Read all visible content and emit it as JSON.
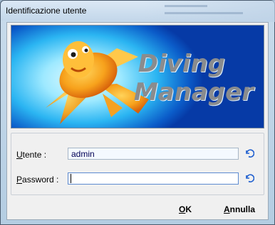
{
  "window": {
    "title": "Identificazione utente"
  },
  "banner": {
    "line1": "Diving",
    "line2": "Manager"
  },
  "form": {
    "username_label_key": "U",
    "username_label_rest": "tente :",
    "username_value": "admin",
    "password_label_key": "P",
    "password_label_rest": "assword :",
    "password_value": ""
  },
  "buttons": {
    "ok_key": "O",
    "ok_rest": "K",
    "cancel_key": "A",
    "cancel_rest": "nnulla"
  },
  "colors": {
    "accent": "#0b5cc9",
    "undo_icon": "#1f5fcf"
  },
  "icons": {
    "undo": "undo-arrow-icon"
  }
}
